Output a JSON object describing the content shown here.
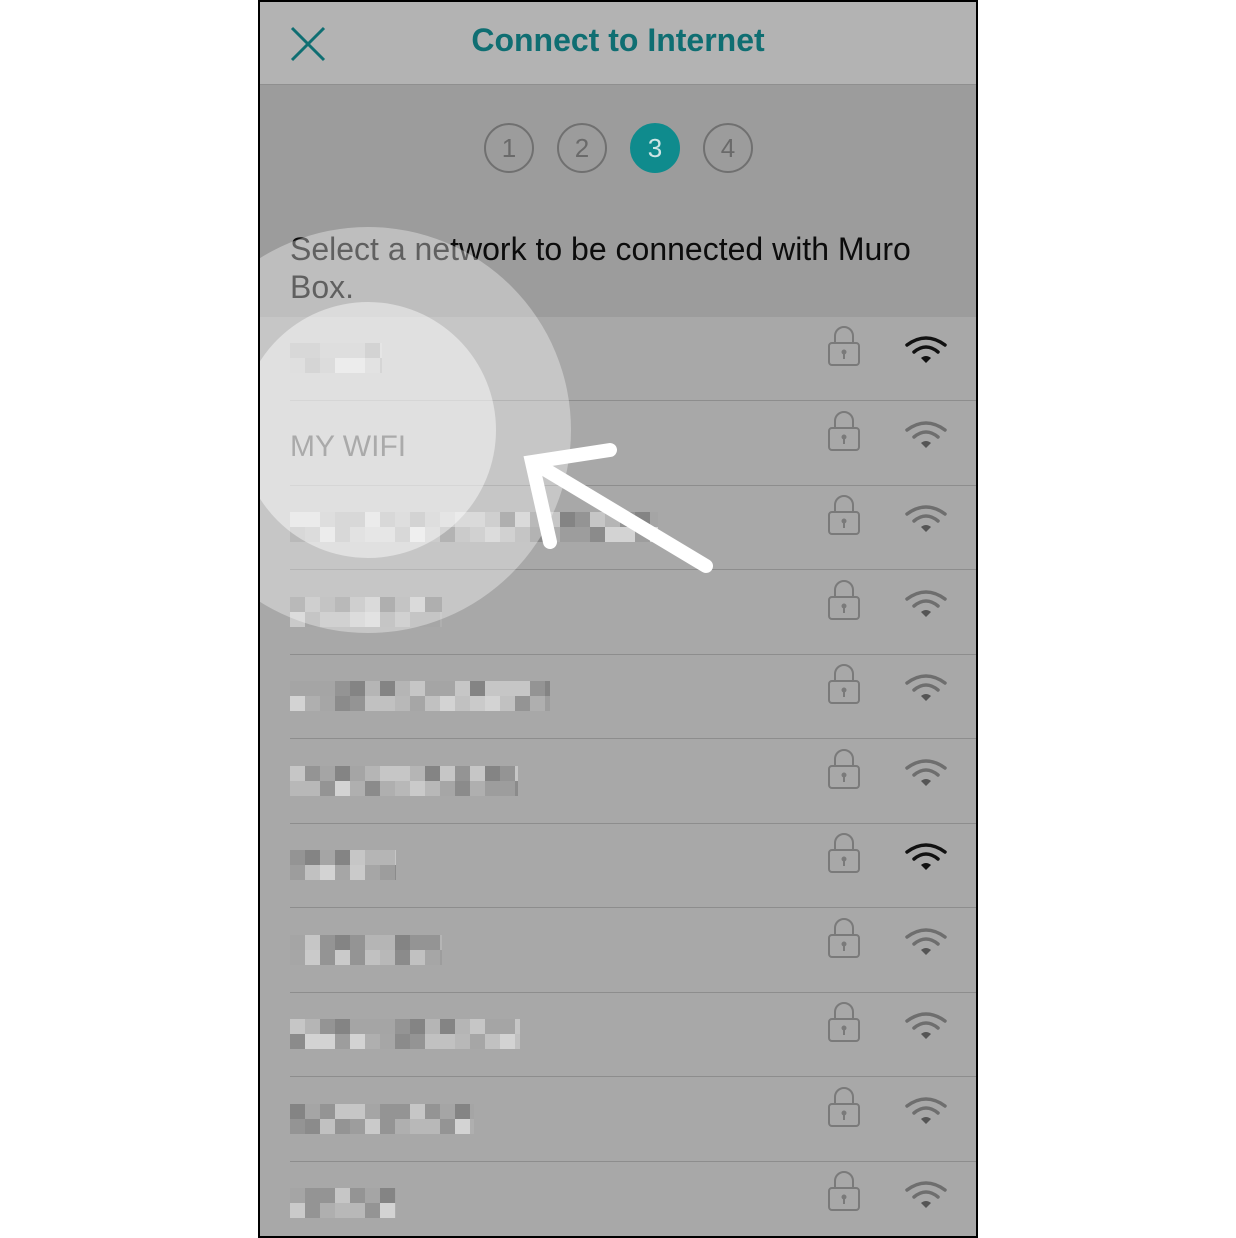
{
  "header": {
    "title": "Connect to Internet"
  },
  "steps": [
    {
      "label": "1",
      "active": false
    },
    {
      "label": "2",
      "active": false
    },
    {
      "label": "3",
      "active": true
    },
    {
      "label": "4",
      "active": false
    }
  ],
  "instruction": "Select a network to be connected with Muro Box.",
  "networks": [
    {
      "name": "",
      "obscured": true,
      "locked": true,
      "signal": "strong"
    },
    {
      "name": "MY WIFI",
      "obscured": false,
      "locked": true,
      "signal": "medium",
      "highlighted": true
    },
    {
      "name": "",
      "obscured": true,
      "locked": true,
      "signal": "medium"
    },
    {
      "name": "",
      "obscured": true,
      "locked": true,
      "signal": "medium"
    },
    {
      "name": "",
      "obscured": true,
      "locked": true,
      "signal": "medium"
    },
    {
      "name": "",
      "obscured": true,
      "locked": true,
      "signal": "medium"
    },
    {
      "name": "",
      "obscured": true,
      "locked": true,
      "signal": "strong"
    },
    {
      "name": "",
      "obscured": true,
      "locked": true,
      "signal": "medium"
    },
    {
      "name": "",
      "obscured": true,
      "locked": true,
      "signal": "medium"
    },
    {
      "name": "",
      "obscured": true,
      "locked": true,
      "signal": "medium"
    },
    {
      "name": "",
      "obscured": true,
      "locked": true,
      "signal": "medium"
    }
  ],
  "colors": {
    "accent": "#0f8b8d",
    "title": "#0f6e72"
  },
  "icons": {
    "close": "close-icon",
    "lock": "lock-icon",
    "wifi": "wifi-signal-icon",
    "arrow": "pointer-arrow"
  }
}
